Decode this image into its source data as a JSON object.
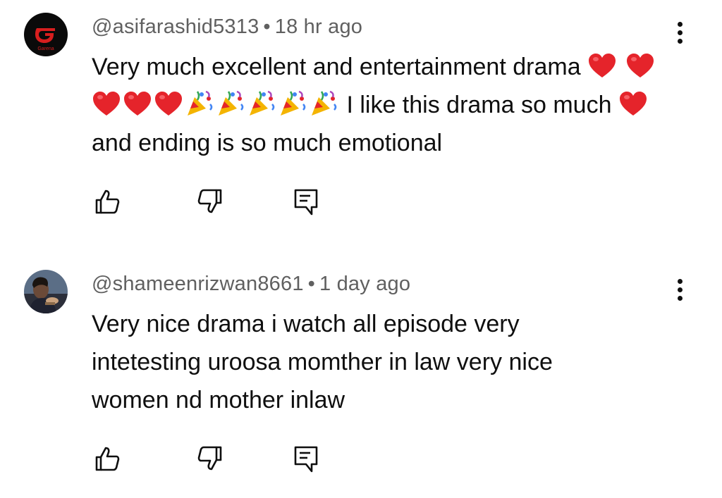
{
  "comments": [
    {
      "handle": "@asifarashid5313",
      "separator": "•",
      "time": "18 hr ago",
      "text_part1": "Very much excellent and entertainment drama",
      "text_part2": "I like this drama so much",
      "text_part3": "and ending is so much emotional",
      "avatar_icon": "garena-logo-icon",
      "avatar_text": "Garena",
      "avatar_bg": "#0a0a0a",
      "avatar_accent": "#d81e1e"
    },
    {
      "handle": "@shameenrizwan8661",
      "separator": "•",
      "time": "1 day ago",
      "text": "Very nice drama i watch all episode very intetesting uroosa momther in law very nice women nd mother inlaw",
      "avatar_icon": "profile-photo"
    }
  ],
  "actions": {
    "like_icon": "thumbs-up-icon",
    "dislike_icon": "thumbs-down-icon",
    "reply_icon": "reply-comment-icon",
    "more_icon": "vertical-ellipsis-icon"
  },
  "colors": {
    "text": "#0f0f0f",
    "secondary_text": "#606060",
    "heart": "#e5242b"
  }
}
